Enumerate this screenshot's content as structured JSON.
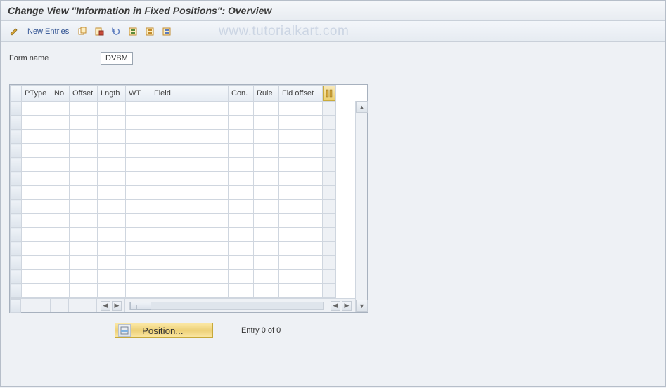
{
  "title": "Change View \"Information in Fixed Positions\": Overview",
  "toolbar": {
    "new_entries": "New Entries",
    "watermark": "www.tutorialkart.com"
  },
  "form": {
    "name_label": "Form name",
    "name_value": "DVBM"
  },
  "table": {
    "columns": [
      "PType",
      "No",
      "Offset",
      "Lngth",
      "WT",
      "Field",
      "Con.",
      "Rule",
      "Fld offset"
    ],
    "rows": 14
  },
  "footer": {
    "position_label": "Position...",
    "status": "Entry 0 of 0"
  }
}
